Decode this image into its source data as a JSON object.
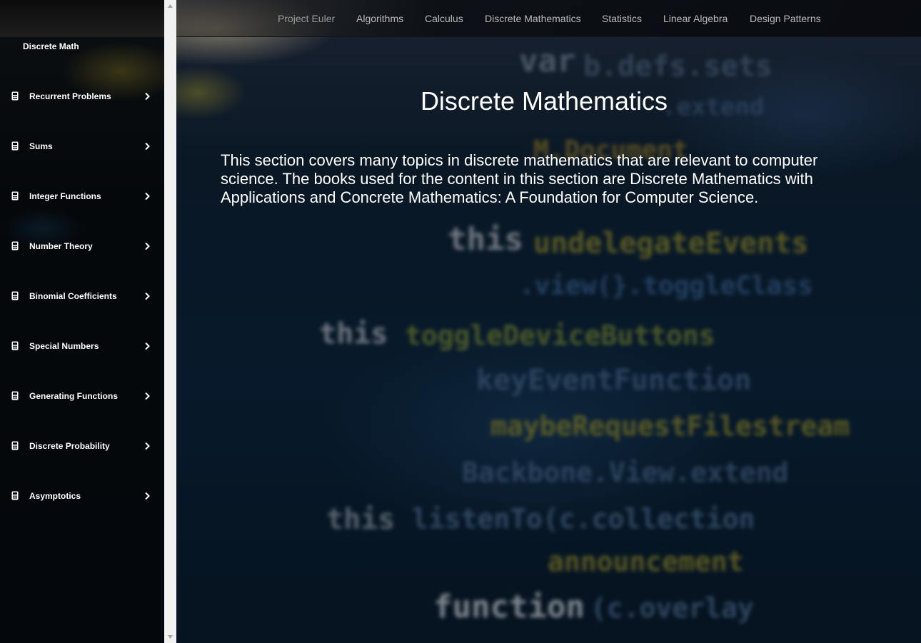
{
  "sidebar": {
    "title": "Discrete Math",
    "items": [
      {
        "label": "Recurrent Problems"
      },
      {
        "label": "Sums"
      },
      {
        "label": "Integer Functions"
      },
      {
        "label": "Number Theory"
      },
      {
        "label": "Binomial Coefficients"
      },
      {
        "label": "Special Numbers"
      },
      {
        "label": "Generating Functions"
      },
      {
        "label": "Discrete Probability"
      },
      {
        "label": "Asymptotics"
      }
    ],
    "item_icon": "calculator-icon",
    "chevron_icon": "chevron-right-icon"
  },
  "nav": {
    "items": [
      {
        "label": "Project Euler"
      },
      {
        "label": "Algorithms"
      },
      {
        "label": "Calculus"
      },
      {
        "label": "Discrete Mathematics"
      },
      {
        "label": "Statistics"
      },
      {
        "label": "Linear Algebra"
      },
      {
        "label": "Design Patterns"
      }
    ]
  },
  "main": {
    "title": "Discrete Mathematics",
    "description": "This section covers many topics in discrete mathematics that are relevant to computer science. The books used for the content in this section are Discrete Mathematics with Applications and Concrete Mathematics: A Foundation for Computer Science."
  },
  "colors": {
    "sidebar_bg": "#05080b",
    "text": "#ffffff",
    "nav_text": "#b9b9b9",
    "scrollbar": "#f1f1f1"
  }
}
